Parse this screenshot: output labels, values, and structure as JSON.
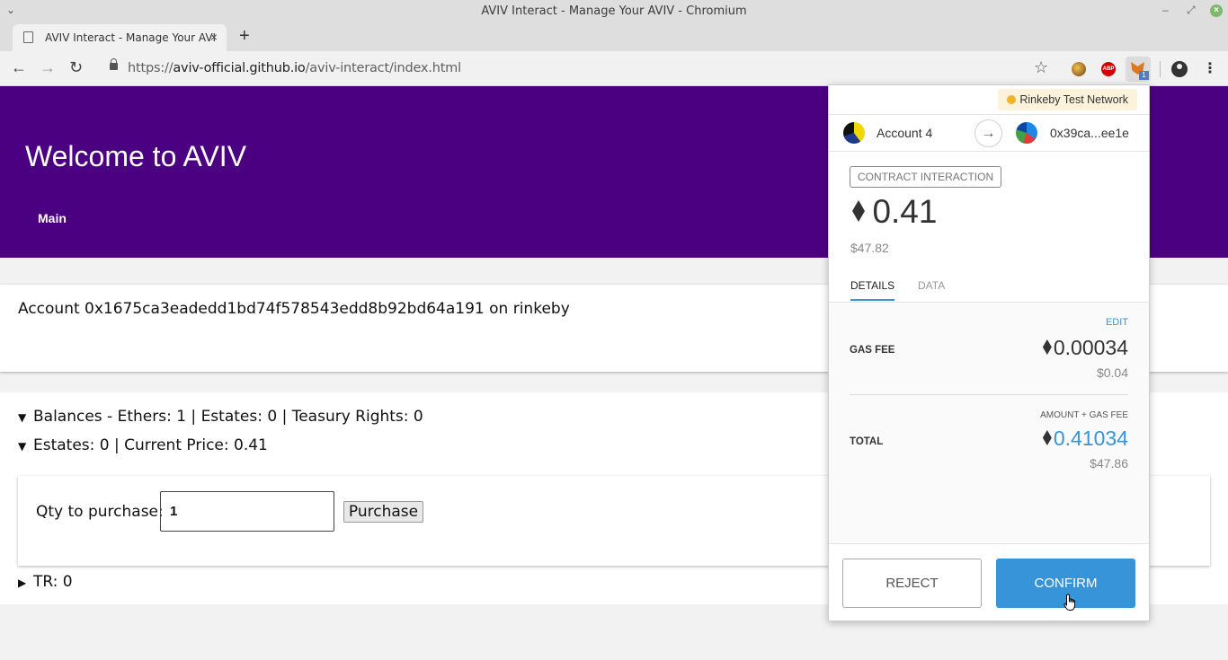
{
  "window": {
    "title": "AVIV Interact - Manage Your AVIV - Chromium"
  },
  "tab": {
    "title": "AVIV Interact - Manage Your AVIV"
  },
  "address_bar": {
    "scheme": "https://",
    "host": "aviv-official.github.io",
    "path": "/aviv-interact/index.html"
  },
  "extensions": {
    "abp_label": "ABP",
    "metamask_badge": "1"
  },
  "hero": {
    "title": "Welcome to AVIV",
    "nav_main": "Main"
  },
  "account": {
    "text": "Account 0x1675ca3eadedd1bd74f578543edd8b92bd64a191 on rinkeby"
  },
  "sections": {
    "balances": "Balances - Ethers: 1 | Estates: 0 | Teasury Rights: 0",
    "estates": "Estates: 0 | Current Price: 0.41",
    "tr": "TR: 0"
  },
  "purchase": {
    "label": "Qty to purchase:",
    "qty_value": "1",
    "button_label": "Purchase"
  },
  "metamask": {
    "network": "Rinkeby Test Network",
    "from_account": "Account 4",
    "to_address": "0x39ca...ee1e",
    "badge": "CONTRACT INTERACTION",
    "amount": "0.41",
    "amount_fiat": "$47.82",
    "tab_details": "DETAILS",
    "tab_data": "DATA",
    "edit_label": "EDIT",
    "gas_fee_label": "GAS FEE",
    "gas_fee_eth": "0.00034",
    "gas_fee_fiat": "$0.04",
    "amount_gas_label": "AMOUNT + GAS FEE",
    "total_label": "TOTAL",
    "total_eth": "0.41034",
    "total_fiat": "$47.86",
    "reject_label": "REJECT",
    "confirm_label": "CONFIRM",
    "accent_color": "#3794d8"
  },
  "colors": {
    "hero_bg": "#4b0082",
    "network_dot": "#f0b429"
  }
}
